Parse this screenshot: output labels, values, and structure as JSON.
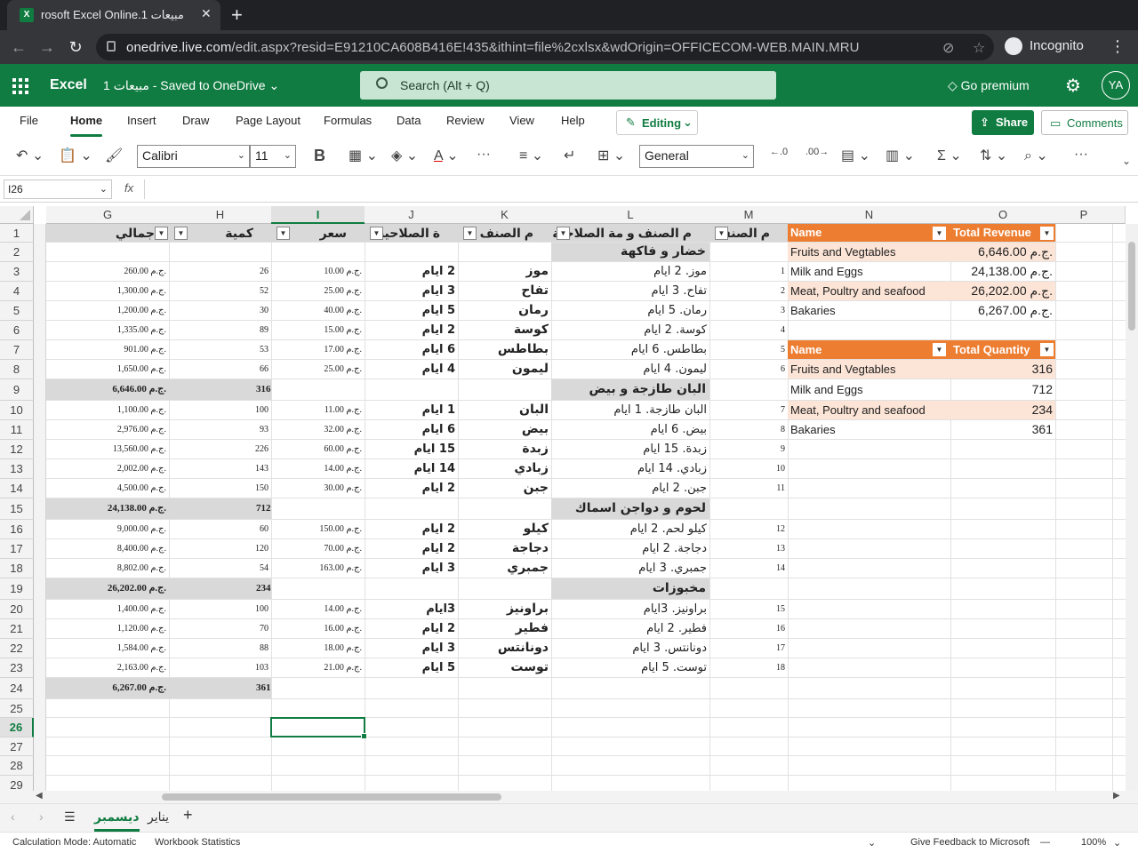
{
  "browser": {
    "tab_title": "rosoft Excel Online.1 مبيعات",
    "tab_icon": "excel-icon",
    "url_host": "onedrive.live.com",
    "url_path": "/edit.aspx?resid=E91210CA608B416E!435&ithint=file%2cxlsx&wdOrigin=OFFICECOM-WEB.MAIN.MRU",
    "incognito_label": "Incognito"
  },
  "excel": {
    "app_name": "Excel",
    "doc_name": "1 مبيعات  -  Saved to OneDrive",
    "search_placeholder": "Search (Alt + Q)",
    "go_premium": "Go premium",
    "avatar": "YA"
  },
  "ribbon": {
    "tabs": [
      "File",
      "Home",
      "Insert",
      "Draw",
      "Page Layout",
      "Formulas",
      "Data",
      "Review",
      "View",
      "Help"
    ],
    "active_tab": "Home",
    "editing": "Editing",
    "share": "Share",
    "comments": "Comments"
  },
  "toolbar": {
    "font": "Calibri",
    "size": "11",
    "number_format": "General",
    "bold": "B"
  },
  "formula_bar": {
    "name_box": "I26",
    "fx": "fx"
  },
  "columns": [
    "G",
    "H",
    "I",
    "J",
    "K",
    "L",
    "M",
    "N",
    "O",
    "P"
  ],
  "selected_column": "I",
  "rows": [
    "1",
    "2",
    "3",
    "4",
    "5",
    "6",
    "7",
    "8",
    "9",
    "10",
    "11",
    "12",
    "13",
    "14",
    "15",
    "16",
    "17",
    "18",
    "19",
    "20",
    "21",
    "22",
    "23",
    "24",
    "25",
    "26",
    "27",
    "28",
    "29"
  ],
  "selected_row": "26",
  "headers": {
    "G": "جمالي",
    "H": "كمية",
    "I": "سعر",
    "J": "ة الصلاحية",
    "K": "م الصنف",
    "L": "م الصنف و مة الصلاحية",
    "M": "م الصنف"
  },
  "groups": [
    {
      "row": 2,
      "title": "خضار و فاكهة"
    },
    {
      "row": 9,
      "title": "البان طازجة و بيض",
      "total": "6,646.00 ج.م.",
      "qty": "316"
    },
    {
      "row": 15,
      "title": "لحوم و دواجن اسماك",
      "total": "24,138.00 ج.م.",
      "qty": "712"
    },
    {
      "row": 19,
      "title": "مخبوزات",
      "total": "26,202.00 ج.م.",
      "qty": "234"
    },
    {
      "row": 24,
      "title": "",
      "total": "6,267.00 ج.م.",
      "qty": "361"
    }
  ],
  "items": [
    {
      "row": 3,
      "total": "260.00 ج.م.",
      "qty": "26",
      "price": "10.00 ج.م.",
      "exp": "2 ايام",
      "name": "موز",
      "combo": "موز. 2 ايام",
      "n": "1"
    },
    {
      "row": 4,
      "total": "1,300.00 ج.م.",
      "qty": "52",
      "price": "25.00 ج.م.",
      "exp": "3 ايام",
      "name": "تفاح",
      "combo": "تفاح. 3 ايام",
      "n": "2"
    },
    {
      "row": 5,
      "total": "1,200.00 ج.م.",
      "qty": "30",
      "price": "40.00 ج.م.",
      "exp": "5 ايام",
      "name": "رمان",
      "combo": "رمان. 5 ايام",
      "n": "3"
    },
    {
      "row": 6,
      "total": "1,335.00 ج.م.",
      "qty": "89",
      "price": "15.00 ج.م.",
      "exp": "2 ايام",
      "name": "كوسة",
      "combo": "كوسة. 2 ايام",
      "n": "4"
    },
    {
      "row": 7,
      "total": "901.00 ج.م.",
      "qty": "53",
      "price": "17.00 ج.م.",
      "exp": "6 ايام",
      "name": "بطاطس",
      "combo": "بطاطس. 6 ايام",
      "n": "5"
    },
    {
      "row": 8,
      "total": "1,650.00 ج.م.",
      "qty": "66",
      "price": "25.00 ج.م.",
      "exp": "4 ايام",
      "name": "ليمون",
      "combo": "ليمون. 4 ايام",
      "n": "6"
    },
    {
      "row": 10,
      "total": "1,100.00 ج.م.",
      "qty": "100",
      "price": "11.00 ج.م.",
      "exp": "1 ايام",
      "name": "البان",
      "combo": "البان طازجة. 1 ايام",
      "n": "7"
    },
    {
      "row": 11,
      "total": "2,976.00 ج.م.",
      "qty": "93",
      "price": "32.00 ج.م.",
      "exp": "6 ايام",
      "name": "بيض",
      "combo": "بيض. 6 ايام",
      "n": "8"
    },
    {
      "row": 12,
      "total": "13,560.00 ج.م.",
      "qty": "226",
      "price": "60.00 ج.م.",
      "exp": "15 ايام",
      "name": "زبدة",
      "combo": "زبدة. 15 ايام",
      "n": "9"
    },
    {
      "row": 13,
      "total": "2,002.00 ج.م.",
      "qty": "143",
      "price": "14.00 ج.م.",
      "exp": "14 ايام",
      "name": "زبادي",
      "combo": "زبادي. 14 ايام",
      "n": "10"
    },
    {
      "row": 14,
      "total": "4,500.00 ج.م.",
      "qty": "150",
      "price": "30.00 ج.م.",
      "exp": "2 ايام",
      "name": "جبن",
      "combo": "جبن. 2 ايام",
      "n": "11"
    },
    {
      "row": 16,
      "total": "9,000.00 ج.م.",
      "qty": "60",
      "price": "150.00 ج.م.",
      "exp": "2 ايام",
      "name": "كيلو",
      "combo": "كيلو لحم. 2 ايام",
      "n": "12"
    },
    {
      "row": 17,
      "total": "8,400.00 ج.م.",
      "qty": "120",
      "price": "70.00 ج.م.",
      "exp": "2 ايام",
      "name": "دجاجة",
      "combo": "دجاجة. 2 ايام",
      "n": "13"
    },
    {
      "row": 18,
      "total": "8,802.00 ج.م.",
      "qty": "54",
      "price": "163.00 ج.م.",
      "exp": "3 ايام",
      "name": "جمبري",
      "combo": "جمبري. 3 ايام",
      "n": "14"
    },
    {
      "row": 20,
      "total": "1,400.00 ج.م.",
      "qty": "100",
      "price": "14.00 ج.م.",
      "exp": "3ايام",
      "name": "براونيز",
      "combo": "براونيز. 3ايام",
      "n": "15"
    },
    {
      "row": 21,
      "total": "1,120.00 ج.م.",
      "qty": "70",
      "price": "16.00 ج.م.",
      "exp": "2 ايام",
      "name": "فطير",
      "combo": "فطير. 2 ايام",
      "n": "16"
    },
    {
      "row": 22,
      "total": "1,584.00 ج.م.",
      "qty": "88",
      "price": "18.00 ج.م.",
      "exp": "3 ايام",
      "name": "دونانتس",
      "combo": "دونانتس. 3 ايام",
      "n": "17"
    },
    {
      "row": 23,
      "total": "2,163.00 ج.م.",
      "qty": "103",
      "price": "21.00 ج.م.",
      "exp": "5 ايام",
      "name": "توست",
      "combo": "توست. 5 ايام",
      "n": "18"
    }
  ],
  "revenue_table": {
    "headers": [
      "Name",
      "Total Revenue"
    ],
    "rows": [
      [
        "Fruits and Vegtables",
        "6,646.00 ج.م."
      ],
      [
        "Milk and Eggs",
        "24,138.00 ج.م."
      ],
      [
        "Meat, Poultry and seafood",
        "26,202.00 ج.م."
      ],
      [
        "Bakaries",
        "6,267.00 ج.م."
      ]
    ]
  },
  "quantity_table": {
    "headers": [
      "Name",
      "Total Quantity"
    ],
    "rows": [
      [
        "Fruits and Vegtables",
        "316"
      ],
      [
        "Milk and Eggs",
        "712"
      ],
      [
        "Meat, Poultry and seafood",
        "234"
      ],
      [
        "Bakaries",
        "361"
      ]
    ]
  },
  "sheets": [
    "ديسمبر",
    "يناير"
  ],
  "active_sheet": "ديسمبر",
  "status": {
    "calc_mode": "Calculation Mode: Automatic",
    "workbook_stats": "Workbook Statistics",
    "feedback": "Give Feedback to Microsoft",
    "zoom": "100%"
  },
  "colors": {
    "excel_green": "#107c41",
    "table_orange": "#ed7d31",
    "table_band": "#fce4d6",
    "header_grey": "#d9d9d9"
  }
}
